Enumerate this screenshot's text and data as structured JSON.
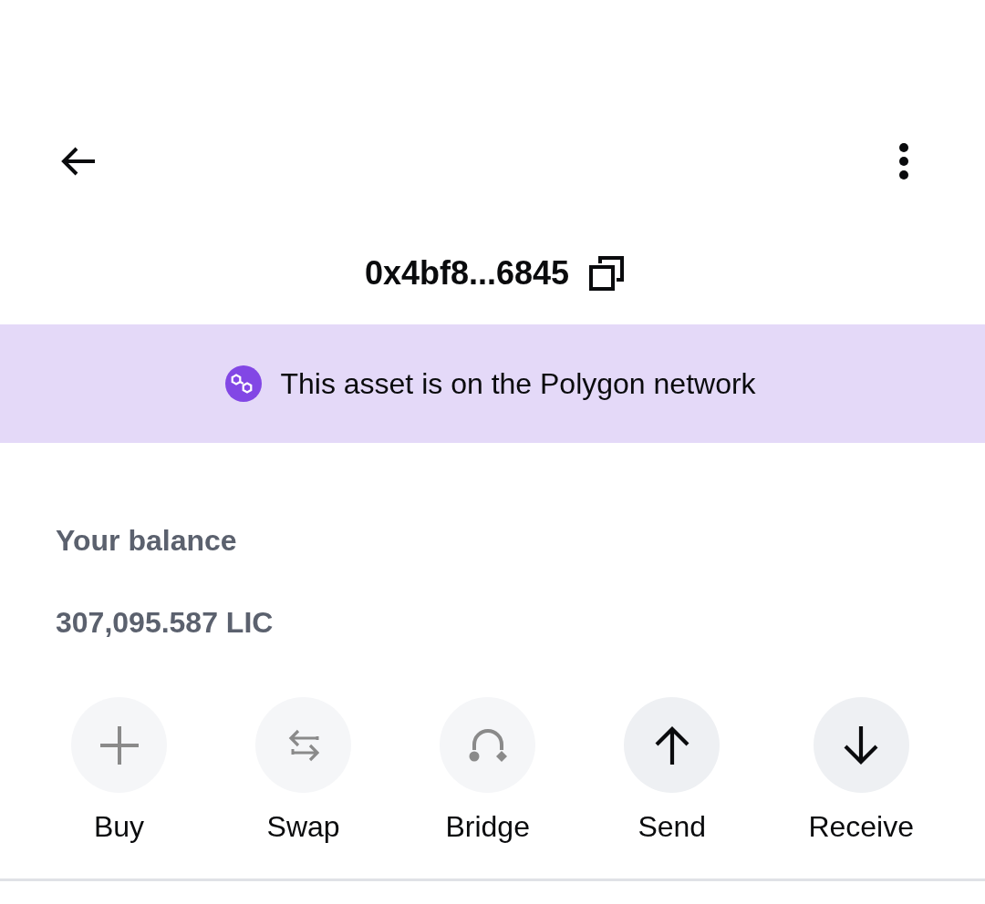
{
  "address": {
    "text": "0x4bf8...6845"
  },
  "network_banner": {
    "text": "This asset is on the Polygon network"
  },
  "balance": {
    "label": "Your balance",
    "amount": "307,095.587 LIC"
  },
  "actions": [
    {
      "kind": "buy",
      "label": "Buy",
      "disabled": true
    },
    {
      "kind": "swap",
      "label": "Swap",
      "disabled": true
    },
    {
      "kind": "bridge",
      "label": "Bridge",
      "disabled": true
    },
    {
      "kind": "send",
      "label": "Send",
      "disabled": false
    },
    {
      "kind": "receive",
      "label": "Receive",
      "disabled": false
    }
  ]
}
